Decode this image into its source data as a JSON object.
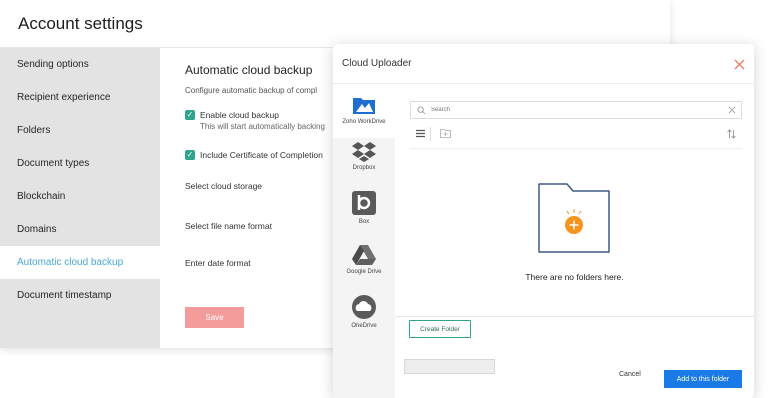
{
  "settings": {
    "title": "Account settings",
    "sidebar": [
      {
        "label": "Sending options",
        "active": false
      },
      {
        "label": "Recipient experience",
        "active": false
      },
      {
        "label": "Folders",
        "active": false
      },
      {
        "label": "Document types",
        "active": false
      },
      {
        "label": "Blockchain",
        "active": false
      },
      {
        "label": "Domains",
        "active": false
      },
      {
        "label": "Automatic cloud backup",
        "active": true
      },
      {
        "label": "Document timestamp",
        "active": false
      }
    ],
    "content": {
      "title": "Automatic cloud backup",
      "description": "Configure automatic backup of compl",
      "enable_backup": {
        "label": "Enable cloud backup",
        "sub": "This will start automatically backing",
        "checked": true
      },
      "include_certificate": {
        "label": "Include Certificate of Completion",
        "checked": true
      },
      "storage_label": "Select cloud storage",
      "file_name_label": "Select file name format",
      "date_format_label": "Enter date format",
      "save_label": "Save"
    }
  },
  "uploader": {
    "title": "Cloud Uploader",
    "providers": [
      {
        "label": "Zoho WorkDrive",
        "icon": "workdrive-icon",
        "active": true
      },
      {
        "label": "Dropbox",
        "icon": "dropbox-icon",
        "active": false
      },
      {
        "label": "Box",
        "icon": "box-icon",
        "active": false
      },
      {
        "label": "Google Drive",
        "icon": "google-drive-icon",
        "active": false
      },
      {
        "label": "OneDrive",
        "icon": "onedrive-icon",
        "active": false
      }
    ],
    "search_placeholder": "Search",
    "empty_message": "There are no folders here.",
    "create_folder_label": "Create Folder",
    "cancel_label": "Cancel",
    "add_label": "Add to this folder"
  },
  "colors": {
    "accent_teal": "#2fa58f",
    "active_link": "#4aa9d6",
    "save_button": "#f39c9b",
    "primary_blue": "#1c7ae6",
    "folder_orange": "#f7941d",
    "folder_outline": "#3f5a87",
    "close_red": "#e8775f"
  }
}
